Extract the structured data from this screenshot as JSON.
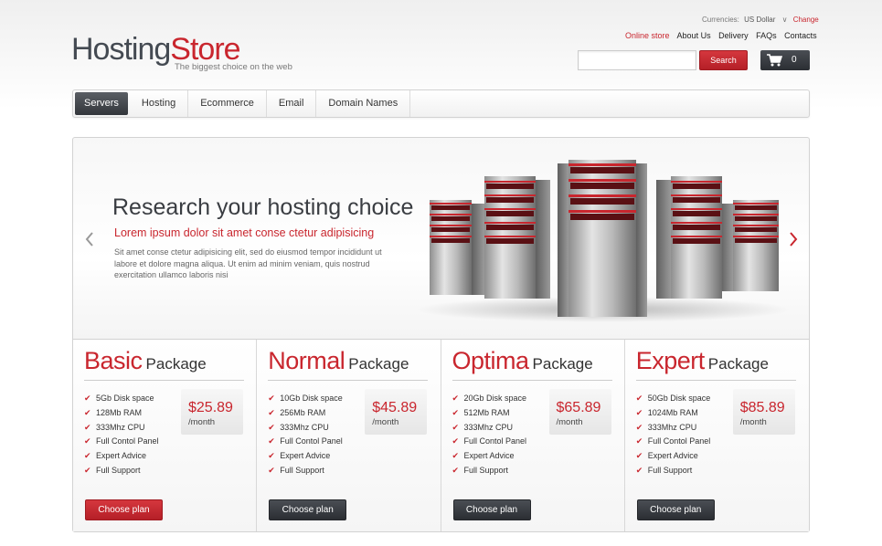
{
  "header": {
    "currency_label": "Currencies:",
    "currency_value": "US Dollar",
    "currency_change": "Change",
    "nav": [
      "Online store",
      "About Us",
      "Delivery",
      "FAQs",
      "Contacts"
    ],
    "logo_part1": "Hosting",
    "logo_part2": "Store",
    "tagline": "The biggest choice on the web",
    "search_placeholder": "",
    "search_button": "Search",
    "cart_count": "0"
  },
  "mainnav": {
    "tabs": [
      "Servers",
      "Hosting",
      "Ecommerce",
      "Email",
      "Domain Names"
    ]
  },
  "slider": {
    "title": "Research your hosting choice",
    "subtitle": "Lorem ipsum dolor sit amet conse ctetur adipisicing",
    "text": "Sit amet conse ctetur adipisicing elit, sed do eiusmod tempor incididunt ut labore et dolore magna aliqua. Ut enim ad minim veniam, quis nostrud exercitation ullamco laboris nisi"
  },
  "packages": [
    {
      "name": "Basic",
      "word": "Package",
      "price": "$25.89",
      "per": "/month",
      "features": [
        "5Gb Disk space",
        "128Mb RAM",
        "333Mhz CPU",
        "Full Contol Panel",
        "Expert Advice",
        "Full Support"
      ],
      "button": "Choose plan"
    },
    {
      "name": "Normal",
      "word": "Package",
      "price": "$45.89",
      "per": "/month",
      "features": [
        "10Gb Disk space",
        "256Mb RAM",
        "333Mhz CPU",
        "Full Contol Panel",
        "Expert Advice",
        "Full Support"
      ],
      "button": "Choose plan"
    },
    {
      "name": "Optima",
      "word": "Package",
      "price": "$65.89",
      "per": "/month",
      "features": [
        "20Gb Disk space",
        "512Mb RAM",
        "333Mhz CPU",
        "Full Contol Panel",
        "Expert Advice",
        "Full Support"
      ],
      "button": "Choose plan"
    },
    {
      "name": "Expert",
      "word": "Package",
      "price": "$85.89",
      "per": "/month",
      "features": [
        "50Gb Disk space",
        "1024Mb RAM",
        "333Mhz CPU",
        "Full Contol Panel",
        "Expert Advice",
        "Full Support"
      ],
      "button": "Choose plan"
    }
  ],
  "colors": {
    "accent": "#c9262e",
    "dark_button": "#33363b"
  }
}
